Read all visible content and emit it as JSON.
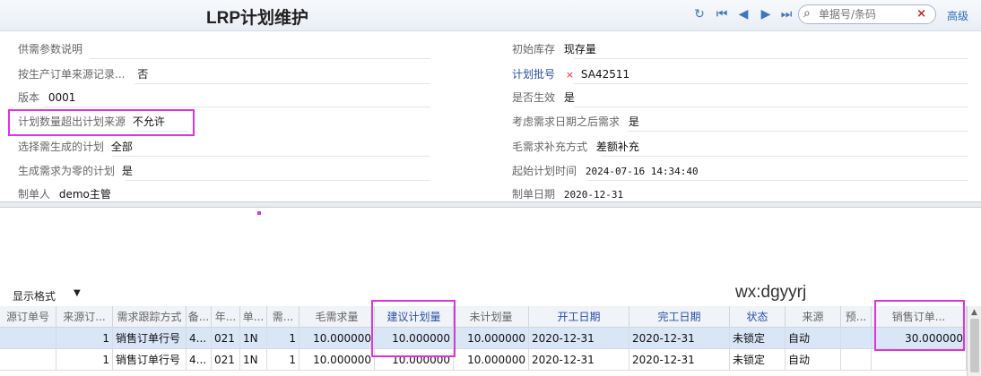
{
  "window": {
    "title": "LRP计划维护"
  },
  "search": {
    "placeholder": "单据号/条码",
    "clear": "×"
  },
  "advanced": "高级",
  "form_left": [
    {
      "label": "供需参数说明",
      "value": ""
    },
    {
      "label": "按生产订单来源记录...",
      "value": "否"
    },
    {
      "label": "版本",
      "value": "0001"
    },
    {
      "label": "计划数量超出计划来源",
      "value": "不允许"
    },
    {
      "label": "选择需生成的计划",
      "value": "全部"
    },
    {
      "label": "生成需求为零的计划",
      "value": "是"
    },
    {
      "label": "制单人",
      "value": "demo主管"
    }
  ],
  "form_right": [
    {
      "label": "初始库存",
      "value": "现存量"
    },
    {
      "label": "计划批号",
      "value": "SA42511",
      "required": "×"
    },
    {
      "label": "是否生效",
      "value": "是"
    },
    {
      "label": "考虑需求日期之后需求",
      "value": "是"
    },
    {
      "label": "毛需求补充方式",
      "value": "差额补充"
    },
    {
      "label": "起始计划时间",
      "value": "2024-07-16 14:34:40"
    },
    {
      "label": "制单日期",
      "value": "2020-12-31"
    }
  ],
  "display_format": "显示格式",
  "watermark": "wx:dgyyrj",
  "table": {
    "headers": [
      "源订单号",
      "来源订...",
      "需求跟踪方式",
      "备...",
      "年...",
      "单...",
      "需...",
      "毛需求量",
      "建议计划量",
      "未计划量",
      "开工日期",
      "完工日期",
      "状态",
      "来源",
      "预...",
      "销售订单..."
    ],
    "rows": [
      [
        "",
        "1",
        "销售订单行号",
        "4...",
        "021",
        "1N",
        "1",
        "10.000000",
        "10.000000",
        "10.000000",
        "2020-12-31",
        "2020-12-31",
        "未锁定",
        "自动",
        "",
        "30.000000"
      ],
      [
        "",
        "1",
        "销售订单行号",
        "4...",
        "021",
        "1N",
        "1",
        "10.000000",
        "10.000000",
        "10.000000",
        "2020-12-31",
        "2020-12-31",
        "未锁定",
        "自动",
        "",
        ""
      ]
    ]
  }
}
